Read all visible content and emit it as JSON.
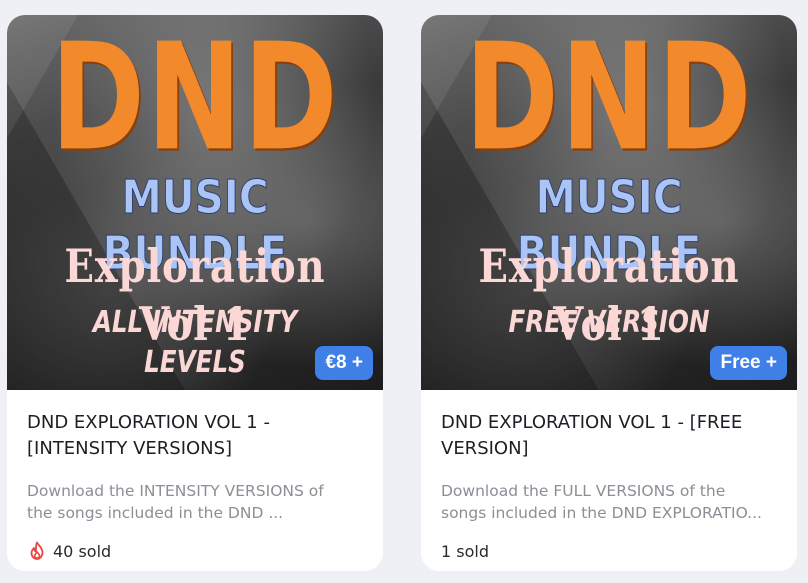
{
  "products": [
    {
      "cover": {
        "logo_line1": "DND",
        "logo_line2": "MUSIC BUNDLE",
        "logo_line3": "Exploration Vol 1",
        "logo_line4": "ALL INTENSITY LEVELS"
      },
      "price_badge": "€8 +",
      "title_line1": "DND EXPLORATION VOL 1 -",
      "title_line2": "[INTENSITY VERSIONS]",
      "description_line1": "Download the INTENSITY VERSIONS of",
      "description_line2": "the songs included in the DND ...",
      "sold": "40 sold",
      "sold_icon": "fire-icon"
    },
    {
      "cover": {
        "logo_line1": "DND",
        "logo_line2": "MUSIC BUNDLE",
        "logo_line3": "Exploration Vol 1",
        "logo_line4": "FREE VERSION"
      },
      "price_badge": "Free +",
      "title_line1": "DND EXPLORATION VOL 1 - [FREE",
      "title_line2": "VERSION]",
      "description_line1": "Download the FULL VERSIONS of the",
      "description_line2": "songs included in the DND EXPLORATIO...",
      "sold": "1 sold",
      "sold_icon": null
    }
  ],
  "colors": {
    "background": "#eef0f5",
    "accent_blue": "#3f7fe8",
    "logo_orange": "#f28a2c",
    "logo_blue": "#a9c4f5",
    "logo_pink": "#fbd7d5",
    "fire_red": "#e9463f"
  }
}
